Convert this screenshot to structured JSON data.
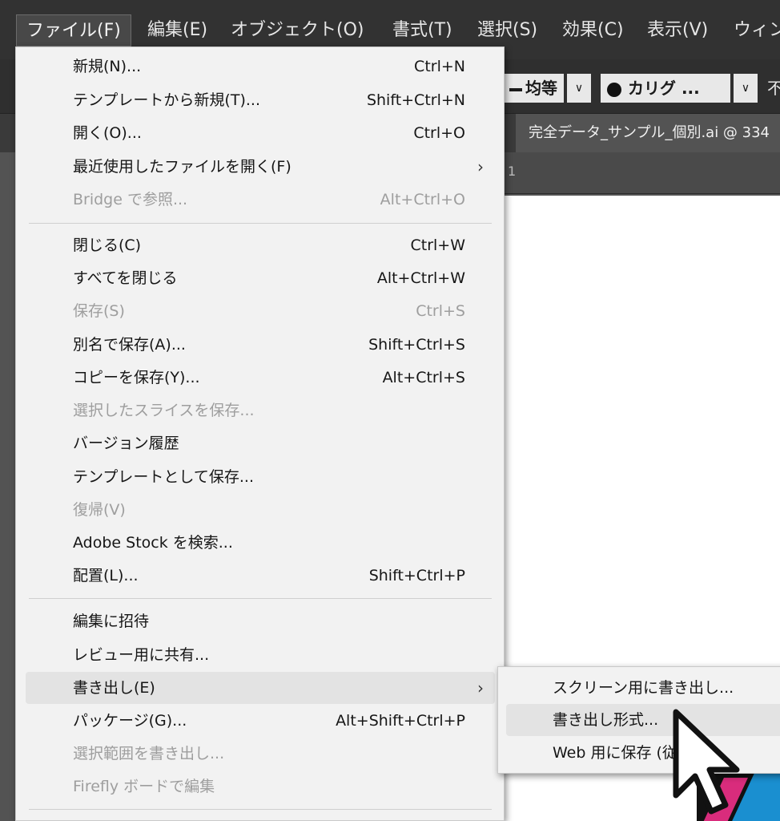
{
  "menubar": {
    "items": [
      "ファイル(F)",
      "編集(E)",
      "オブジェクト(O)",
      "書式(T)",
      "選択(S)",
      "効果(C)",
      "表示(V)",
      "ウィン"
    ]
  },
  "controlbar": {
    "stroke_profile": "均等",
    "brush": "カリグ ...",
    "trailing": "不"
  },
  "document": {
    "tab_title": "完全データ_サンプル_個別.ai @ 334",
    "ruler_label": "1"
  },
  "file_menu": {
    "items": [
      {
        "label": "新規(N)...",
        "shortcut": "Ctrl+N"
      },
      {
        "label": "テンプレートから新規(T)...",
        "shortcut": "Shift+Ctrl+N"
      },
      {
        "label": "開く(O)...",
        "shortcut": "Ctrl+O"
      },
      {
        "label": "最近使用したファイルを開く(F)",
        "shortcut": "",
        "arrow": "›"
      },
      {
        "label": "Bridge で参照...",
        "shortcut": "Alt+Ctrl+O"
      },
      {
        "label": "閉じる(C)",
        "shortcut": "Ctrl+W"
      },
      {
        "label": "すべてを閉じる",
        "shortcut": "Alt+Ctrl+W"
      },
      {
        "label": "保存(S)",
        "shortcut": "Ctrl+S"
      },
      {
        "label": "別名で保存(A)...",
        "shortcut": "Shift+Ctrl+S"
      },
      {
        "label": "コピーを保存(Y)...",
        "shortcut": "Alt+Ctrl+S"
      },
      {
        "label": "選択したスライスを保存...",
        "shortcut": ""
      },
      {
        "label": "バージョン履歴",
        "shortcut": ""
      },
      {
        "label": "テンプレートとして保存...",
        "shortcut": ""
      },
      {
        "label": "復帰(V)",
        "shortcut": ""
      },
      {
        "label": "Adobe Stock を検索...",
        "shortcut": ""
      },
      {
        "label": "配置(L)...",
        "shortcut": "Shift+Ctrl+P"
      },
      {
        "label": "編集に招待",
        "shortcut": ""
      },
      {
        "label": "レビュー用に共有...",
        "shortcut": ""
      },
      {
        "label": "書き出し(E)",
        "shortcut": "",
        "arrow": "›"
      },
      {
        "label": "パッケージ(G)...",
        "shortcut": "Alt+Shift+Ctrl+P"
      },
      {
        "label": "選択範囲を書き出し...",
        "shortcut": ""
      },
      {
        "label": "Firefly ボードで編集",
        "shortcut": ""
      }
    ]
  },
  "export_submenu": {
    "items": [
      {
        "label": "スクリーン用に書き出し..."
      },
      {
        "label": "書き出し形式..."
      },
      {
        "label": "Web 用に保存 (従来)..."
      }
    ]
  },
  "colors": {
    "menu_bg": "#f2f2f2",
    "highlight": "#e3e3e3",
    "disabled_text": "#9e9e9e",
    "app_chrome": "#323232"
  }
}
